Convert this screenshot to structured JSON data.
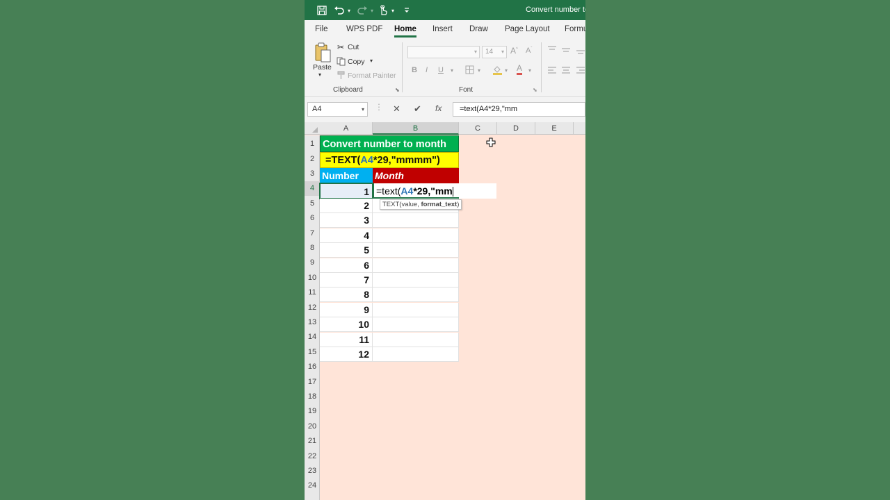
{
  "window": {
    "title": "Convert number to"
  },
  "tabs": [
    "File",
    "WPS PDF",
    "Home",
    "Insert",
    "Draw",
    "Page Layout",
    "Formu"
  ],
  "active_tab": "Home",
  "ribbon": {
    "paste": "Paste",
    "cut": "Cut",
    "copy": "Copy",
    "format_painter": "Format Painter",
    "clipboard_group": "Clipboard",
    "font_group": "Font",
    "font_size": "14",
    "bold": "B",
    "italic": "I",
    "underline": "U",
    "font_color_glyph": "A"
  },
  "formula_bar": {
    "name_box": "A4",
    "cancel_glyph": "✕",
    "enter_glyph": "✔",
    "fx_glyph": "fx",
    "formula": "=text(A4*29,\"mm"
  },
  "columns": [
    "A",
    "B",
    "C",
    "D",
    "E"
  ],
  "rows": [
    "1",
    "2",
    "3",
    "4",
    "5",
    "6",
    "7",
    "8",
    "9",
    "10",
    "11",
    "12",
    "13",
    "14",
    "15",
    "16",
    "17",
    "18",
    "19",
    "20",
    "21",
    "22",
    "23",
    "24"
  ],
  "sheet": {
    "title": "Convert number to month",
    "formula_prefix": "=TEXT(",
    "formula_ref": "A4",
    "formula_suffix": "*29,\"mmmm\")",
    "header_number": "Number",
    "header_month": "Month",
    "numbers": [
      "1",
      "2",
      "3",
      "4",
      "5",
      "6",
      "7",
      "8",
      "9",
      "10",
      "11",
      "12"
    ],
    "editing_prefix": "=text(",
    "editing_ref": "A4",
    "editing_suffix": "*29,\"mm"
  },
  "tooltip": {
    "text": "TEXT(value, ",
    "bold": "format_text",
    "close": ")"
  },
  "colors": {
    "title_bar": "#217346",
    "title_cell": "#00b050",
    "formula_cell": "#ffff00",
    "number_header": "#00b0f0",
    "month_header": "#c00000",
    "sheet_background": "#ffe4d8",
    "outer_background": "#478055"
  }
}
